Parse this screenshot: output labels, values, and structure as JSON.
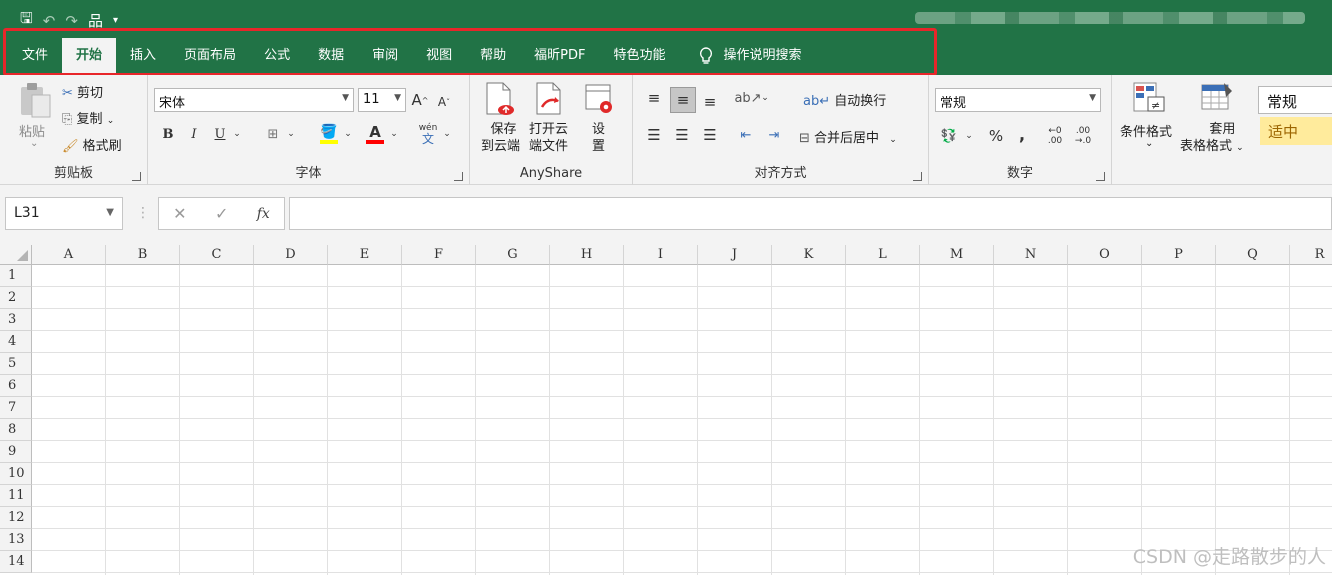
{
  "qat": {
    "save": "🖫",
    "undo": "↶",
    "redo": "↷",
    "tree": "品",
    "more": "▾"
  },
  "tabs": [
    "文件",
    "开始",
    "插入",
    "页面布局",
    "公式",
    "数据",
    "审阅",
    "视图",
    "帮助",
    "福昕PDF",
    "特色功能"
  ],
  "tell_me": "操作说明搜索",
  "clipboard": {
    "paste": "粘贴",
    "cut": "剪切",
    "copy": "复制",
    "format_painter": "格式刷",
    "label": "剪贴板"
  },
  "font": {
    "name": "宋体",
    "size": "11",
    "grow": "A",
    "shrink": "A",
    "bold": "B",
    "italic": "I",
    "underline": "U",
    "font_color_letter": "A",
    "phonetic": "wén",
    "phonetic_char": "文",
    "label": "字体"
  },
  "anyshare": {
    "save_cloud": [
      "保存",
      "到云端"
    ],
    "open_cloud": [
      "打开云",
      "端文件"
    ],
    "settings": [
      "设",
      "置"
    ],
    "label": "AnyShare"
  },
  "alignment": {
    "wrap_text": "自动换行",
    "merge_center": "合并后居中",
    "label": "对齐方式"
  },
  "number": {
    "format": "常规",
    "percent": "%",
    "comma": ",",
    "inc_decimal": ".00",
    "dec_decimal": ".00",
    "label": "数字"
  },
  "styles": {
    "conditional": "条件格式",
    "table_format": [
      "套用",
      "表格格式"
    ],
    "normal": "常规",
    "neutral": "适中"
  },
  "formula_bar": {
    "name_box": "L31",
    "cancel": "✕",
    "enter": "✓",
    "fx": "fx",
    "value": ""
  },
  "columns": [
    "A",
    "B",
    "C",
    "D",
    "E",
    "F",
    "G",
    "H",
    "I",
    "J",
    "K",
    "L",
    "M",
    "N",
    "O",
    "P",
    "Q",
    "R"
  ],
  "rows": [
    "1",
    "2",
    "3",
    "4",
    "5",
    "6",
    "7",
    "8",
    "9",
    "10",
    "11",
    "12",
    "13",
    "14"
  ],
  "watermark": "CSDN @走路散步的人",
  "colors": {
    "excel_green": "#217346",
    "highlight_red": "#e8262a",
    "neutral_fill": "#ffeb9c"
  }
}
